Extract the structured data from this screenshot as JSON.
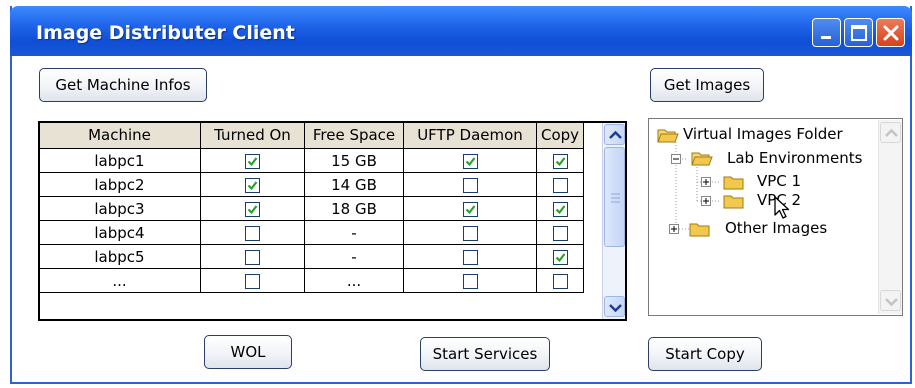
{
  "window": {
    "title": "Image Distributer Client",
    "controls": [
      "minimize-icon",
      "maximize-icon",
      "close-icon"
    ]
  },
  "buttons": {
    "get_machine_infos": "Get Machine Infos",
    "get_images": "Get Images",
    "wol": "WOL",
    "start_services": "Start Services",
    "start_copy": "Start Copy"
  },
  "machines_table": {
    "headers": [
      "Machine",
      "Turned On",
      "Free Space",
      "UFTP Daemon",
      "Copy"
    ],
    "rows": [
      {
        "machine": "labpc1",
        "turned_on": true,
        "free_space": "15 GB",
        "uftp_daemon": true,
        "copy": true
      },
      {
        "machine": "labpc2",
        "turned_on": true,
        "free_space": "14 GB",
        "uftp_daemon": false,
        "copy": false
      },
      {
        "machine": "labpc3",
        "turned_on": true,
        "free_space": "18 GB",
        "uftp_daemon": true,
        "copy": true
      },
      {
        "machine": "labpc4",
        "turned_on": false,
        "free_space": "-",
        "uftp_daemon": false,
        "copy": false
      },
      {
        "machine": "labpc5",
        "turned_on": false,
        "free_space": "-",
        "uftp_daemon": false,
        "copy": true
      },
      {
        "machine": "...",
        "turned_on": false,
        "free_space": "...",
        "uftp_daemon": false,
        "copy": false
      }
    ]
  },
  "image_tree": {
    "root": "Virtual Images Folder",
    "lab_environments": "Lab Environments",
    "vpc1": "VPC 1",
    "vpc2": "VPC 2",
    "other_images": "Other Images"
  },
  "colors": {
    "titlebar": "#1f63e8",
    "check": "#27a327",
    "header_bg": "#e7e2d4",
    "folder": "#f2c94c"
  }
}
